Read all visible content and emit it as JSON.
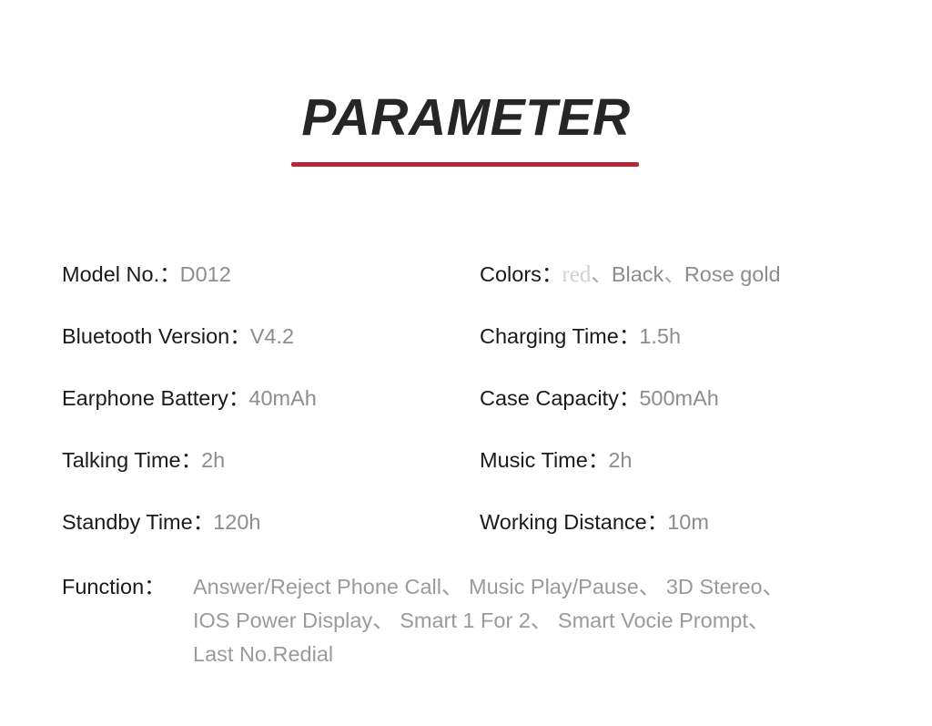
{
  "header": {
    "title": "PARAMETER",
    "rule_color": "#b92638"
  },
  "colors": {
    "label": "#1a1a1a",
    "value": "#8d8d8d",
    "value_faint": "#d2d2d2",
    "accent": "#b92638",
    "background": "#ffffff"
  },
  "punctuation": {
    "colon": "：",
    "enum_comma": "、"
  },
  "specs": {
    "rows": [
      {
        "left": {
          "label": "Model No.",
          "value": "D012"
        },
        "right": {
          "label": "Colors",
          "value": "red、 Black、 Rose gold"
        }
      },
      {
        "left": {
          "label": "Bluetooth Version",
          "value": "V4.2"
        },
        "right": {
          "label": "Charging Time",
          "value": "1.5h"
        }
      },
      {
        "left": {
          "label": "Earphone Battery",
          "value": "40mAh"
        },
        "right": {
          "label": "Case Capacity",
          "value": "500mAh"
        }
      },
      {
        "left": {
          "label": "Talking Time",
          "value": "2h"
        },
        "right": {
          "label": "Music Time",
          "value": "2h"
        }
      },
      {
        "left": {
          "label": "Standby Time",
          "value": "120h"
        },
        "right": {
          "label": "Working Distance",
          "value": "10m"
        }
      }
    ],
    "colors_value_parts": {
      "red": "red",
      "sep1": "、",
      "black": "Black",
      "sep2": "、",
      "rose_gold": "Rose gold"
    }
  },
  "function": {
    "label": "Function",
    "items": [
      "Answer/Reject Phone Call",
      "Music Play/Pause",
      "3D Stereo",
      "IOS Power Display",
      "Smart 1 For 2",
      "Smart Vocie Prompt",
      "Last No.Redial"
    ],
    "lines": [
      "Answer/Reject Phone Call、 Music Play/Pause、 3D Stereo、",
      "IOS Power Display、 Smart 1 For 2、 Smart Vocie Prompt、",
      "Last No.Redial"
    ]
  }
}
